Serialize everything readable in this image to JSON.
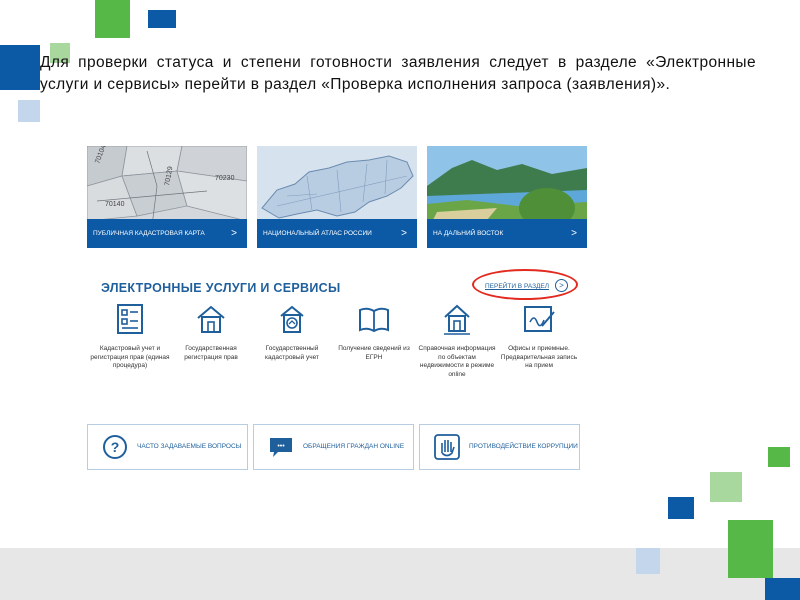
{
  "slide": {
    "paragraph": "Для проверки статуса и степени готовности заявления следует в разделе «Электронные услуги и сервисы» перейти в раздел «Проверка исполнения запроса (заявления)»."
  },
  "screenshot": {
    "tiles": [
      {
        "label": "ПУБЛИЧНАЯ КАДАСТРОВАЯ КАРТА",
        "map_labels": [
          "70104",
          "70129",
          "70140",
          "70230"
        ]
      },
      {
        "label": "НАЦИОНАЛЬНЫЙ АТЛАС РОССИИ"
      },
      {
        "label": "НА ДАЛЬНИЙ ВОСТОК"
      }
    ],
    "chevron": ">",
    "section_title": "ЭЛЕКТРОННЫЕ УСЛУГИ И СЕРВИСЫ",
    "goto_link": "ПЕРЕЙТИ В РАЗДЕЛ",
    "goto_icon": ">",
    "services": [
      {
        "label": "Кадастровый учет и регистрация прав (единая процедура)",
        "icon": "form-icon"
      },
      {
        "label": "Государственная регистрация прав",
        "icon": "house-icon"
      },
      {
        "label": "Государственный кадастровый учет",
        "icon": "house-circle-icon"
      },
      {
        "label": "Получение сведений из ЕГРН",
        "icon": "book-icon"
      },
      {
        "label": "Справочная информация по объектам недвижимости в режиме online",
        "icon": "house-pin-icon"
      },
      {
        "label": "Офисы и приемные. Предварительная запись на прием",
        "icon": "signature-icon"
      }
    ],
    "buttons": [
      {
        "label": "ЧАСТО ЗАДАВАЕМЫЕ ВОПРОСЫ",
        "icon": "question-icon"
      },
      {
        "label": "ОБРАЩЕНИЯ ГРАЖДАН ONLINE",
        "icon": "chat-icon"
      },
      {
        "label": "ПРОТИВОДЕЙСТВИЕ КОРРУПЦИИ",
        "icon": "hand-icon"
      }
    ],
    "icons_glyphs": {
      "question": "?",
      "chat": "•••"
    }
  },
  "colors": {
    "accent_blue": "#0c5aa6",
    "brand_green": "#56b947",
    "highlight_red": "#e22a1f"
  }
}
